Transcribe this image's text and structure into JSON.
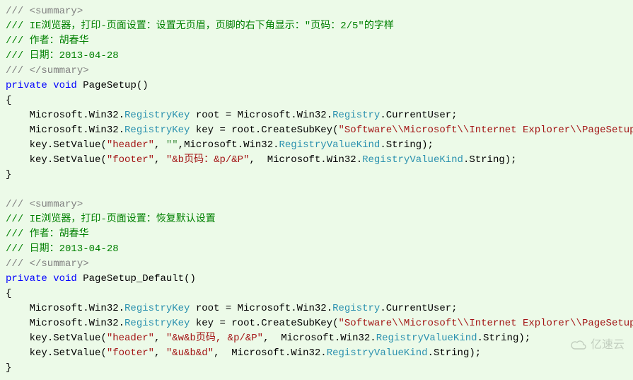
{
  "c1": {
    "a": "/// <summary>",
    "b": "/// IE浏览器，打印-页面设置：设置无页眉，页脚的右下角显示：\"页码：2/5\"的字样",
    "c": "/// 作者：胡春华",
    "d": "/// 日期：2013-04-28",
    "e": "/// </summary>"
  },
  "m1": {
    "kw1": "private",
    "kw2": "void",
    "name": "PageSetup",
    "ns": "Microsoft.Win32.",
    "rk": "RegistryKey",
    "root": " root = Microsoft.Win32.",
    "reg": "Registry",
    "cu": ".CurrentUser;",
    "key_a": " key = root.CreateSubKey(",
    "key_s": "\"Software\\\\Microsoft\\\\Internet Explorer\\\\PageSetup\"",
    "key_e": ");",
    "sv1a": "key.SetValue(",
    "sv1s1": "\"header\"",
    "sv1comma": ", ",
    "sv1s2": "\"\"",
    "sv1mid": ",Microsoft.Win32.",
    "rvk": "RegistryValueKind",
    "sv1end": ".String);",
    "sv2s1": "\"footer\"",
    "sv2s2": "\"&b页码：&p/&P\"",
    "sv2mid": ",  Microsoft.Win32.",
    "sv2end": ".String);"
  },
  "c2": {
    "a": "/// <summary>",
    "b": "/// IE浏览器，打印-页面设置：恢复默认设置",
    "c": "/// 作者：胡春华",
    "d": "/// 日期：2013-04-28",
    "e": "/// </summary>"
  },
  "m2": {
    "kw1": "private",
    "kw2": "void",
    "name": "PageSetup_Default",
    "sv1s1": "\"header\"",
    "sv1s2": "\"&w&b页码, &p/&P\"",
    "sv1mid": ",  Microsoft.Win32.",
    "sv2s1": "\"footer\"",
    "sv2s2": "\"&u&b&d\""
  },
  "wm": "亿速云"
}
